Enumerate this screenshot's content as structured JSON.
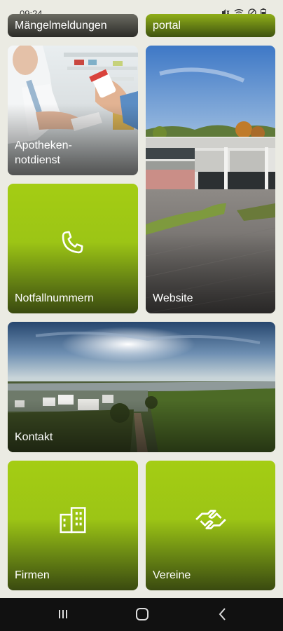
{
  "status": {
    "time": "09:24"
  },
  "tiles": {
    "maengel": {
      "label": "Mängelmeldungen"
    },
    "portal": {
      "label": "portal"
    },
    "apotheken": {
      "label": "Apotheken-\nnotdienst"
    },
    "website": {
      "label": "Website"
    },
    "notfall": {
      "label": "Notfallnummern",
      "icon": "phone-icon"
    },
    "kontakt": {
      "label": "Kontakt"
    },
    "firmen": {
      "label": "Firmen",
      "icon": "buildings-icon"
    },
    "vereine": {
      "label": "Vereine",
      "icon": "handshake-icon"
    }
  },
  "colors": {
    "accent": "#a4cd14",
    "background": "#ebebe3"
  },
  "navbar": {
    "buttons": [
      "recent-apps-icon",
      "home-icon",
      "back-icon"
    ]
  }
}
